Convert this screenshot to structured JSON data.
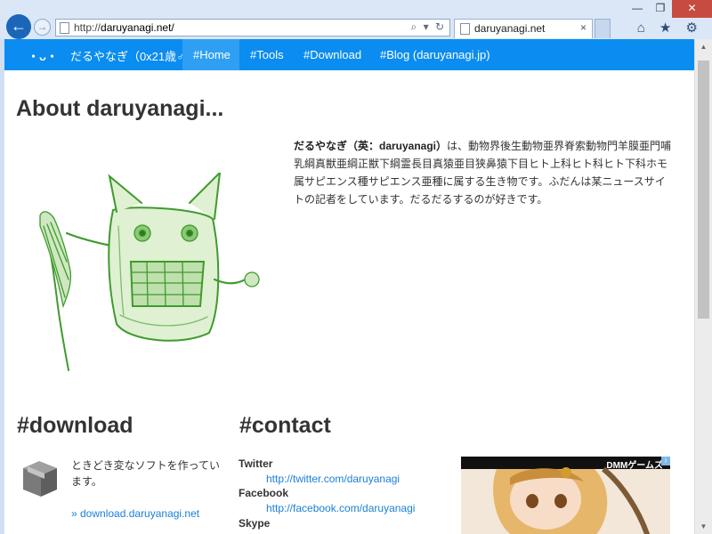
{
  "browser": {
    "url_prefix": "http://",
    "url_host": "daruyanagi.net/",
    "tab_title": "daruyanagi.net",
    "tab_close": "×",
    "back_glyph": "←",
    "forward_glyph": "→",
    "address_tools": "⌕ ▾ ↻",
    "right_icons": "⌂ ★ ⚙",
    "win_min": "—",
    "win_max": "❐",
    "win_close": "✕"
  },
  "site": {
    "logo": "・ᴗ・",
    "brand": "だるやなぎ（0x21歳♂）",
    "nav": [
      {
        "label": "#Home",
        "active": true
      },
      {
        "label": "#Tools"
      },
      {
        "label": "#Download"
      },
      {
        "label": "#Blog (daruyanagi.jp)"
      }
    ]
  },
  "about": {
    "heading": "About daruyanagi...",
    "intro_name": "だるやなぎ（英：daruyanagi）",
    "intro_text": "は、動物界後生動物亜界脊索動物門羊膜亜門哺乳綱真獣亜綱正獣下綱霊長目真猿亜目狭鼻猿下目ヒト上科ヒト科ヒト下科ホモ属サピエンス種サピエンス亜種に属する生き物です。ふだんは某ニュースサイトの記者をしています。だるだるするのが好きです。"
  },
  "download": {
    "heading": "#download",
    "text": "ときどき変なソフトを作っています。",
    "link": "» download.daruyanagi.net"
  },
  "contact": {
    "heading": "#contact",
    "twitter_label": "Twitter",
    "twitter_url": "http://twitter.com/daruyanagi",
    "facebook_label": "Facebook",
    "facebook_url": "http://facebook.com/daruyanagi",
    "skype_label": "Skype"
  },
  "ad": {
    "label": "DMMゲームズ",
    "info": "i"
  },
  "scroll": {
    "up": "▲",
    "down": "▼"
  },
  "colors": {
    "nav_bg": "#0a8cf1",
    "link": "#1a7fd9",
    "mascot_green": "#3f9b2c"
  }
}
